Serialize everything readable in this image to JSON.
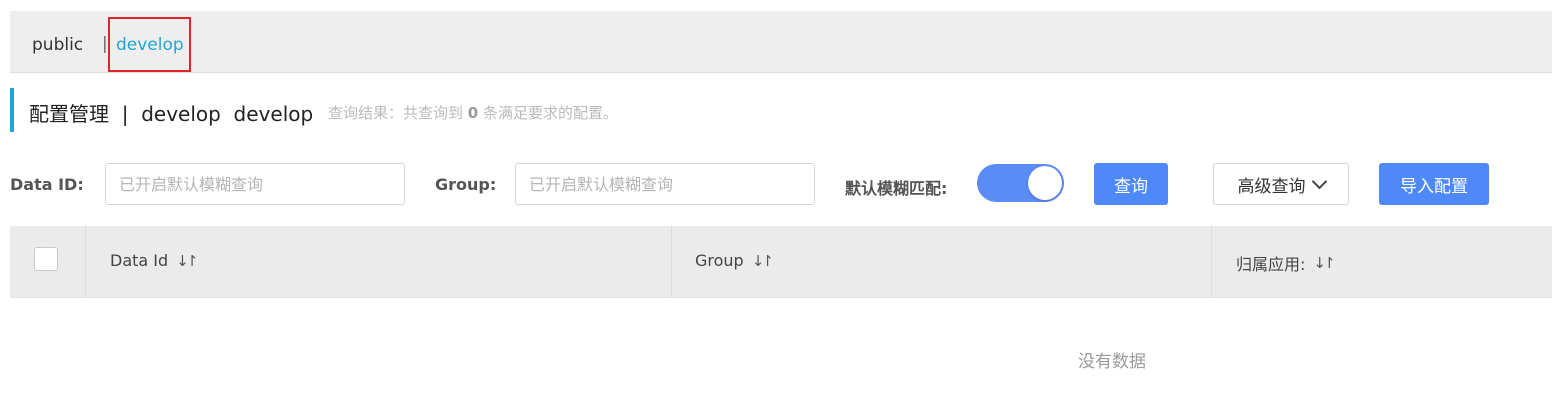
{
  "namespaces": {
    "items": [
      "public",
      "develop"
    ],
    "separator": "|",
    "active": "develop"
  },
  "header": {
    "title": "配置管理",
    "title_sep": "|",
    "namespace_name": "develop",
    "namespace_id": "develop",
    "result_prefix": "查询结果：共查询到",
    "result_count": "0",
    "result_suffix": "条满足要求的配置。"
  },
  "search": {
    "data_id_label": "Data ID:",
    "data_id_placeholder": "已开启默认模糊查询",
    "group_label": "Group:",
    "group_placeholder": "已开启默认模糊查询",
    "fuzzy_label": "默认模糊匹配:",
    "fuzzy_enabled": true,
    "query_button": "查询",
    "advanced_button": "高级查询",
    "import_button": "导入配置"
  },
  "table": {
    "columns": [
      "Data Id",
      "Group",
      "归属应用:"
    ],
    "sort_icon": "sort-icon",
    "empty_text": "没有数据"
  },
  "colors": {
    "accent": "#1fa6d6",
    "primary_button": "#4f89f7",
    "highlight_box": "#e0242b"
  }
}
